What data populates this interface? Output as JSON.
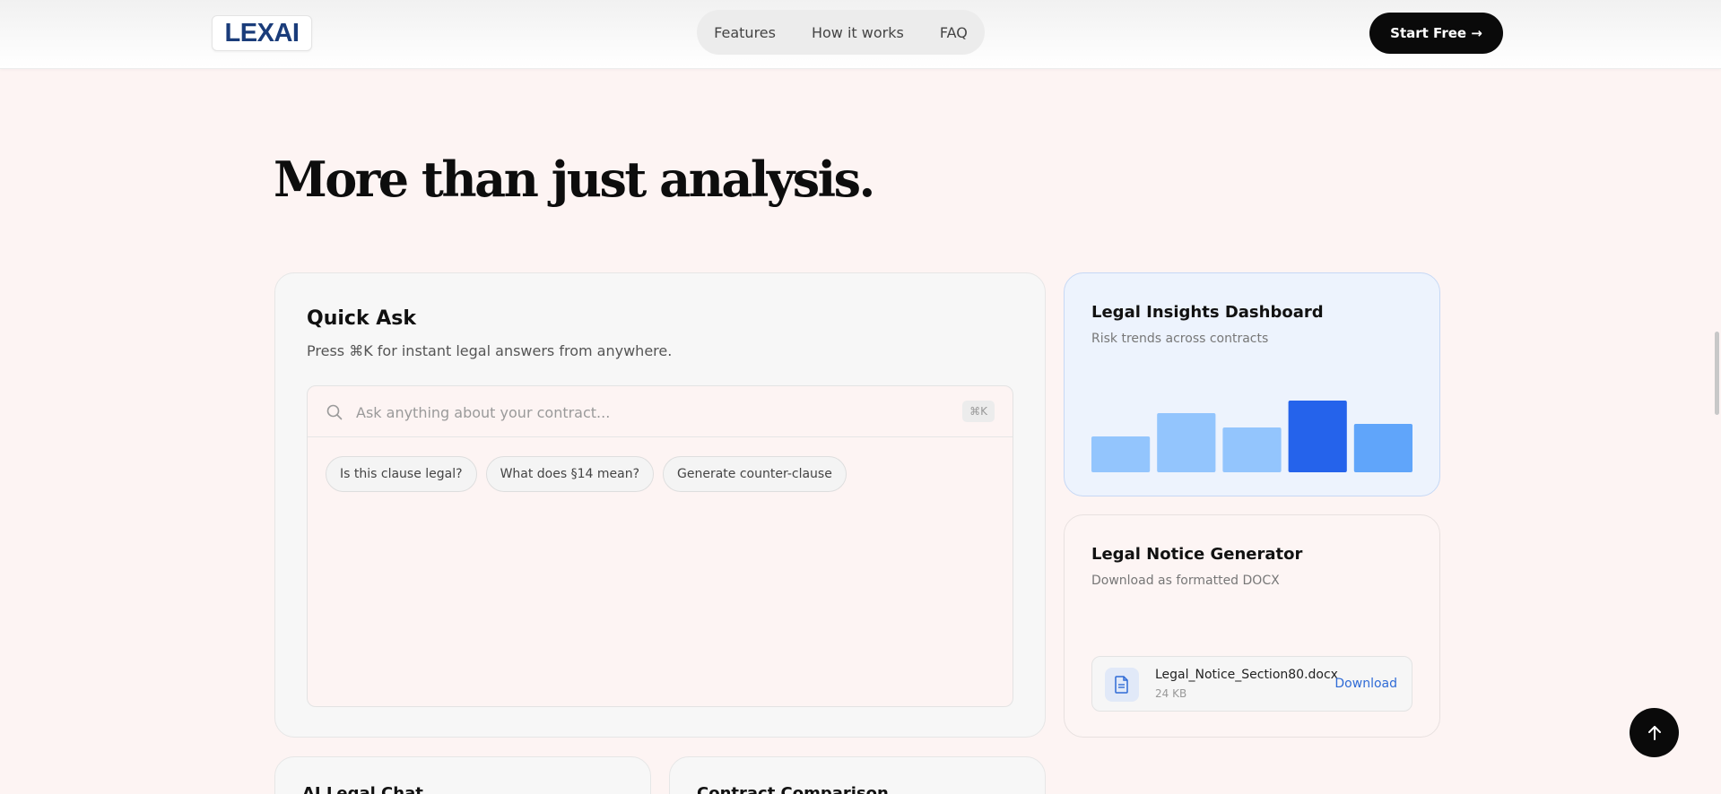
{
  "header": {
    "logo_text": "LEXAI",
    "nav": [
      "Features",
      "How it works",
      "FAQ"
    ],
    "cta_label": "Start Free →"
  },
  "hero": {
    "title": "More than just analysis."
  },
  "quick_ask": {
    "title": "Quick Ask",
    "subtitle": "Press ⌘K for instant legal answers from anywhere.",
    "placeholder": "Ask anything about your contract...",
    "shortcut": "⌘K",
    "chips": [
      "Is this clause legal?",
      "What does §14 mean?",
      "Generate counter-clause"
    ]
  },
  "insights": {
    "title": "Legal Insights Dashboard",
    "subtitle": "Risk trends across contracts",
    "bar_levels": [
      0.5,
      0.82,
      0.62,
      1.0,
      0.68
    ],
    "bar_colors": [
      "#93c5fd",
      "#93c5fd",
      "#93c5fd",
      "#2563eb",
      "#60a5fa"
    ]
  },
  "notice": {
    "title": "Legal Notice Generator",
    "subtitle": "Download as formatted DOCX",
    "file_name": "Legal_Notice_Section80.docx",
    "file_size": "24 KB",
    "download_label": "Download"
  },
  "bottom_cards": [
    "AI Legal Chat",
    "Contract Comparison"
  ],
  "colors": {
    "accent": "#2f6bd6",
    "background": "#fdf4f3"
  }
}
